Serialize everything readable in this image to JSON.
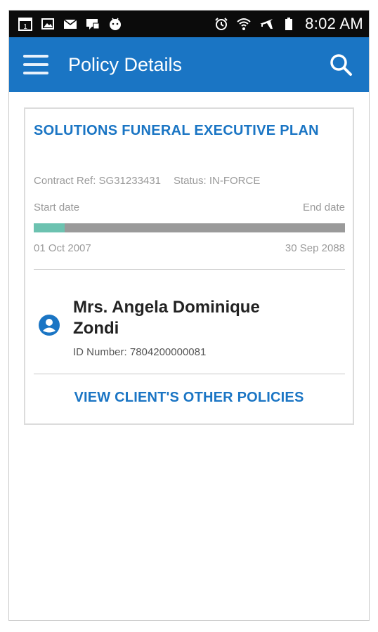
{
  "status_bar": {
    "time": "8:02 AM",
    "left_icons": [
      "calendar-icon",
      "gallery-icon",
      "mail-icon",
      "messages-icon",
      "android-icon"
    ],
    "right_icons": [
      "alarm-icon",
      "wifi-icon",
      "airplane-mode-icon",
      "battery-icon"
    ]
  },
  "app_bar": {
    "title": "Policy Details",
    "background_color": "#1a75c4",
    "menu_icon": "menu-icon",
    "search_icon": "search-icon"
  },
  "policy": {
    "plan_name": "SOLUTIONS FUNERAL EXECUTIVE PLAN",
    "contract_ref_label": "Contract Ref:",
    "contract_ref": "SG31233431",
    "status_label": "Status:",
    "status": "IN-FORCE",
    "start_date_label": "Start date",
    "end_date_label": "End date",
    "start_date": "01 Oct 2007",
    "end_date": "30 Sep 2088",
    "elapsed_fraction": 0.1,
    "progress_fill_color": "#6cc2b0",
    "progress_track_color": "#9a9a9a"
  },
  "client": {
    "icon": "account-circle-icon",
    "name": "Mrs. Angela Dominique Zondi",
    "id_label": "ID Number:",
    "id_number": "7804200000081"
  },
  "actions": {
    "view_other_policies": "VIEW CLIENT'S OTHER POLICIES"
  }
}
